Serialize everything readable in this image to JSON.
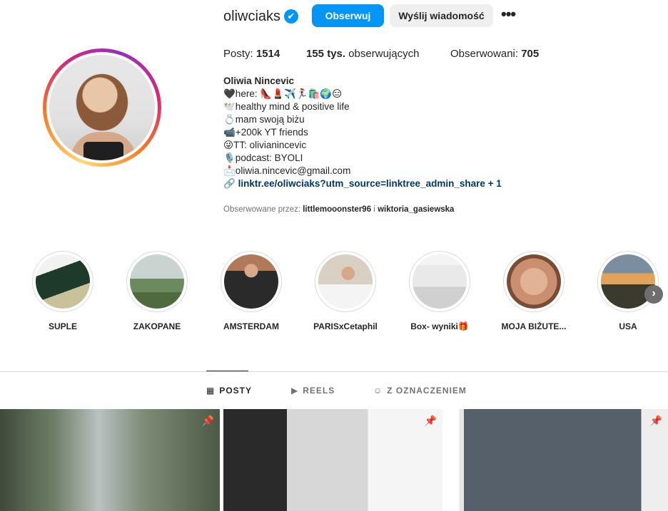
{
  "profile": {
    "username": "oliwciaks",
    "verified_symbol": "✔",
    "follow_label": "Obserwuj",
    "message_label": "Wyślij wiadomość",
    "more_label": "•••"
  },
  "stats": {
    "posts_label": "Posty:",
    "posts_value": "1514",
    "followers_value": "155 tys.",
    "followers_label": "obserwujących",
    "following_label": "Obserwowani:",
    "following_value": "705"
  },
  "bio": {
    "name": "Oliwia Nincevic",
    "lines": [
      "🖤here: 👠💄✈️🏃‍♀️🛍️🌍😑",
      "🕊️healthy mind & positive life",
      "💍mam swoją biżu",
      "📹+200k YT friends",
      "😜TT: olivianincevic",
      "🎙️podcast: BYOLI",
      "📩oliwia.nincevic@gmail.com"
    ],
    "link_icon": "🔗",
    "link": "linktr.ee/oliwciaks?utm_source=linktree_admin_share + 1"
  },
  "followed_by": {
    "prefix": "Obserwowane przez:",
    "user1": "littlemooonster96",
    "conjunction": "i",
    "user2": "wiktoria_gasiewska"
  },
  "highlights": [
    {
      "label": "SUPLE"
    },
    {
      "label": "ZAKOPANE"
    },
    {
      "label": "AMSTERDAM"
    },
    {
      "label": "PARISxCetaphil"
    },
    {
      "label": "Box- wyniki🎁"
    },
    {
      "label": "MOJA BIŻUTE..."
    },
    {
      "label": "USA"
    }
  ],
  "highlights_next_icon": "›",
  "tabs": [
    {
      "label": "POSTY",
      "icon": "▦"
    },
    {
      "label": "REELS",
      "icon": "▶"
    },
    {
      "label": "Z OZNACZENIEM",
      "icon": "☺"
    }
  ],
  "pin_icon": "📌"
}
